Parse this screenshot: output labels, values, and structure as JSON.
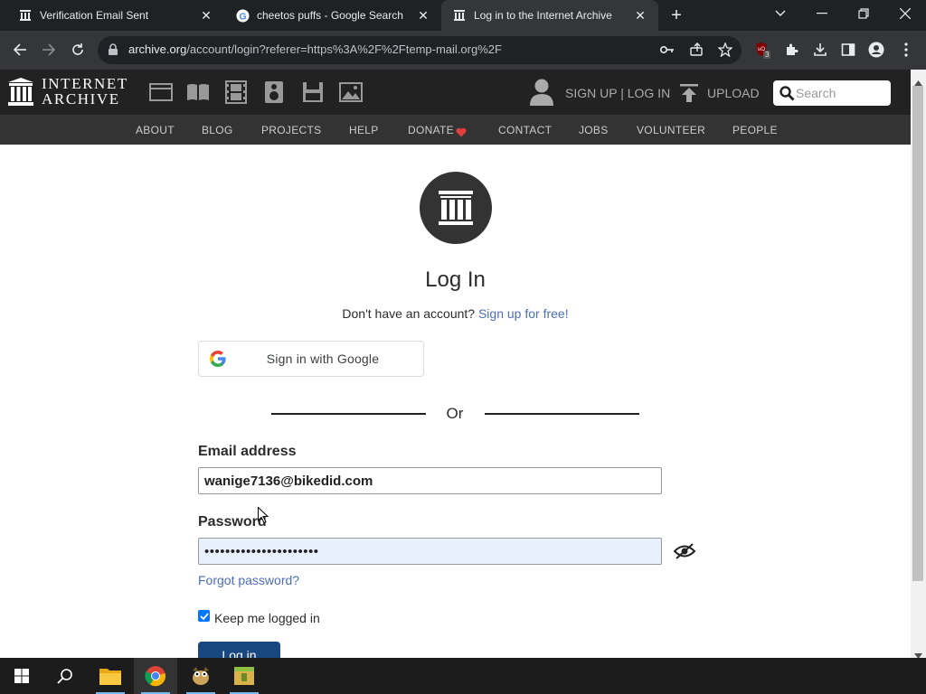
{
  "browser": {
    "tabs": [
      {
        "title": "Verification Email Sent",
        "active": false
      },
      {
        "title": "cheetos puffs - Google Search",
        "active": false
      },
      {
        "title": "Log in to the Internet Archive",
        "active": true
      }
    ],
    "url_host": "archive.org",
    "url_path": "/account/login?referer=https%3A%2F%2Ftemp-mail.org%2F",
    "extension_badge": "3"
  },
  "header": {
    "logo_line1": "INTERNET",
    "logo_line2": "ARCHIVE",
    "signup_login": "SIGN UP | LOG IN",
    "upload": "UPLOAD",
    "search_placeholder": "Search"
  },
  "nav": {
    "items": [
      "ABOUT",
      "BLOG",
      "PROJECTS",
      "HELP",
      "DONATE",
      "CONTACT",
      "JOBS",
      "VOLUNTEER",
      "PEOPLE"
    ]
  },
  "login": {
    "heading": "Log In",
    "no_account": "Don't have an account?",
    "signup_link": "Sign up for free!",
    "google_button": "Sign in with Google",
    "or": "Or",
    "email_label": "Email address",
    "email_value": "wanige7136@bikedid.com",
    "password_label": "Password",
    "password_value": "••••••••••••••••••••••",
    "forgot": "Forgot password?",
    "keep_logged_in": "Keep me logged in",
    "login_button": "Log in"
  },
  "colors": {
    "accent_link": "#4c6eb5",
    "header_bg": "#222222",
    "nav_bg": "#333333",
    "login_button_bg": "#194880",
    "donate_heart": "#e23c3c"
  }
}
